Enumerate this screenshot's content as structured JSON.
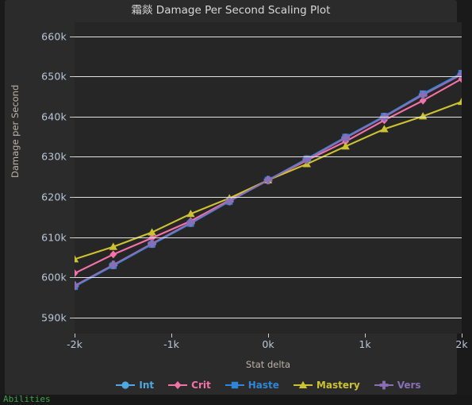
{
  "window": {
    "background": "#1b1a1a",
    "figure_background": "#2b2b2b",
    "axes_background": "#262626"
  },
  "statusbar": {
    "text": "Abilities"
  },
  "chart_data": {
    "type": "line",
    "title": "霜燚 Damage Per Second Scaling Plot",
    "xlabel": "Stat delta",
    "ylabel": "Damage per Second",
    "grid": true,
    "legend_position": "bottom",
    "xlim": [
      -2000,
      2000
    ],
    "ylim": [
      586000,
      663500
    ],
    "xticks": [
      -2000,
      -1000,
      0,
      1000,
      2000
    ],
    "xtick_labels": [
      "-2k",
      "-1k",
      "0k",
      "1k",
      "2k"
    ],
    "yticks": [
      590000,
      600000,
      610000,
      620000,
      630000,
      640000,
      650000,
      660000
    ],
    "ytick_labels": [
      "590k",
      "600k",
      "610k",
      "620k",
      "630k",
      "640k",
      "650k",
      "660k"
    ],
    "x": [
      -2000,
      -1600,
      -1200,
      -800,
      -400,
      0,
      400,
      800,
      1200,
      1600,
      2000
    ],
    "series": [
      {
        "name": "Int",
        "color": "#4fa8e0",
        "marker": "circle",
        "values": [
          597800,
          603000,
          608300,
          613500,
          619000,
          624200,
          629400,
          634800,
          640000,
          645600,
          650700
        ]
      },
      {
        "name": "Crit",
        "color": "#f472a8",
        "marker": "diamond",
        "values": [
          601000,
          605700,
          609800,
          614000,
          619200,
          624200,
          629100,
          633800,
          639100,
          644000,
          649400
        ]
      },
      {
        "name": "Haste",
        "color": "#2e86d8",
        "marker": "square",
        "values": [
          597700,
          602900,
          608200,
          613400,
          618900,
          624200,
          629500,
          634900,
          640100,
          645700,
          650800
        ]
      },
      {
        "name": "Mastery",
        "color": "#cdc332",
        "marker": "triangle",
        "values": [
          604500,
          607600,
          611200,
          615800,
          619700,
          624200,
          628200,
          632600,
          636900,
          640100,
          643700
        ]
      },
      {
        "name": "Vers",
        "color": "#8a6fb5",
        "marker": "plus",
        "values": [
          597900,
          603100,
          608400,
          613600,
          619000,
          624200,
          629300,
          634700,
          639900,
          645400,
          650500
        ]
      }
    ]
  }
}
